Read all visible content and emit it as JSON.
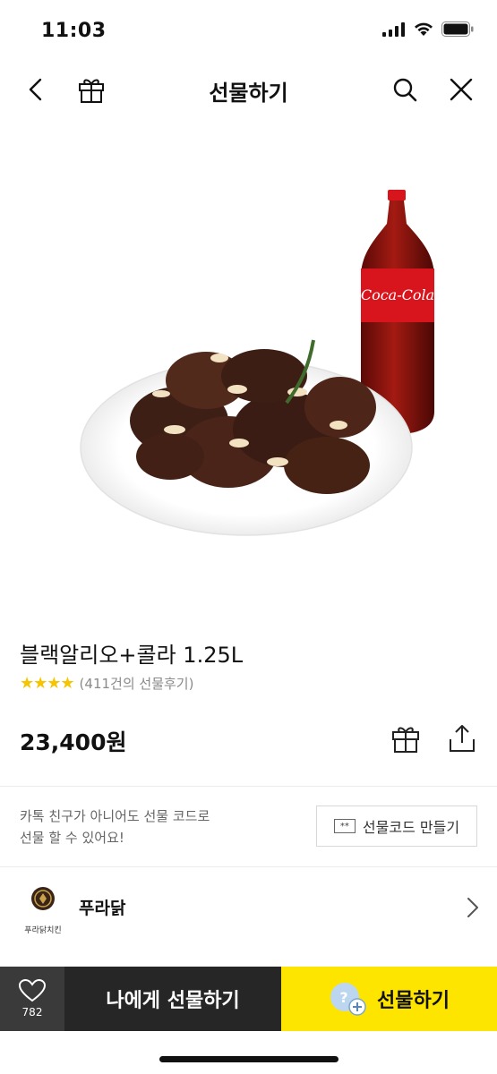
{
  "status_bar": {
    "time": "11:03"
  },
  "nav": {
    "title": "선물하기"
  },
  "product": {
    "title": "블랙알리오+콜라 1.25L",
    "rating_stars": 4,
    "review_text": "(411건의 선물후기)",
    "price": "23,400원",
    "bottle_brand": "Coca-Cola"
  },
  "gift_code": {
    "message_line1": "카톡 친구가 아니어도 선물 코드로",
    "message_line2": "선물 할 수 있어요!",
    "button_label": "선물코드 만들기",
    "button_icon_text": "**"
  },
  "brand": {
    "name": "푸라닭",
    "logo_caption": "푸라닭치킨"
  },
  "bottom_bar": {
    "like_count": "782",
    "gift_me_label": "나에게 선물하기",
    "gift_label": "선물하기"
  },
  "colors": {
    "accent_yellow": "#fee500",
    "star": "#f6c500",
    "dark": "#262626"
  }
}
